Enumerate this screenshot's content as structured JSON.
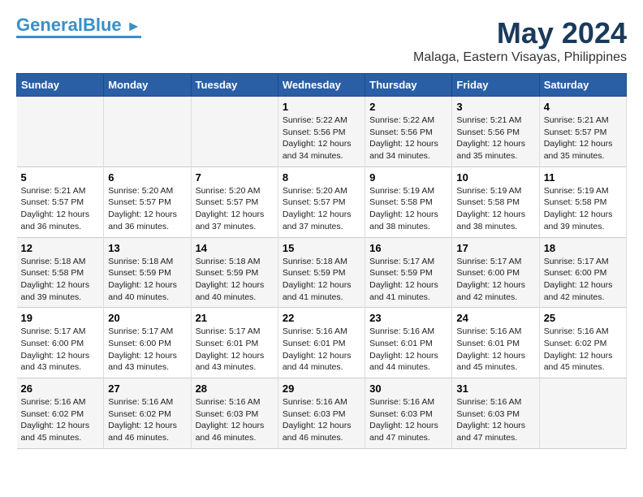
{
  "header": {
    "logo_general": "General",
    "logo_blue": "Blue",
    "title": "May 2024",
    "subtitle": "Malaga, Eastern Visayas, Philippines"
  },
  "days_of_week": [
    "Sunday",
    "Monday",
    "Tuesday",
    "Wednesday",
    "Thursday",
    "Friday",
    "Saturday"
  ],
  "weeks": [
    [
      {
        "day": "",
        "info": ""
      },
      {
        "day": "",
        "info": ""
      },
      {
        "day": "",
        "info": ""
      },
      {
        "day": "1",
        "info": "Sunrise: 5:22 AM\nSunset: 5:56 PM\nDaylight: 12 hours\nand 34 minutes."
      },
      {
        "day": "2",
        "info": "Sunrise: 5:22 AM\nSunset: 5:56 PM\nDaylight: 12 hours\nand 34 minutes."
      },
      {
        "day": "3",
        "info": "Sunrise: 5:21 AM\nSunset: 5:56 PM\nDaylight: 12 hours\nand 35 minutes."
      },
      {
        "day": "4",
        "info": "Sunrise: 5:21 AM\nSunset: 5:57 PM\nDaylight: 12 hours\nand 35 minutes."
      }
    ],
    [
      {
        "day": "5",
        "info": "Sunrise: 5:21 AM\nSunset: 5:57 PM\nDaylight: 12 hours\nand 36 minutes."
      },
      {
        "day": "6",
        "info": "Sunrise: 5:20 AM\nSunset: 5:57 PM\nDaylight: 12 hours\nand 36 minutes."
      },
      {
        "day": "7",
        "info": "Sunrise: 5:20 AM\nSunset: 5:57 PM\nDaylight: 12 hours\nand 37 minutes."
      },
      {
        "day": "8",
        "info": "Sunrise: 5:20 AM\nSunset: 5:57 PM\nDaylight: 12 hours\nand 37 minutes."
      },
      {
        "day": "9",
        "info": "Sunrise: 5:19 AM\nSunset: 5:58 PM\nDaylight: 12 hours\nand 38 minutes."
      },
      {
        "day": "10",
        "info": "Sunrise: 5:19 AM\nSunset: 5:58 PM\nDaylight: 12 hours\nand 38 minutes."
      },
      {
        "day": "11",
        "info": "Sunrise: 5:19 AM\nSunset: 5:58 PM\nDaylight: 12 hours\nand 39 minutes."
      }
    ],
    [
      {
        "day": "12",
        "info": "Sunrise: 5:18 AM\nSunset: 5:58 PM\nDaylight: 12 hours\nand 39 minutes."
      },
      {
        "day": "13",
        "info": "Sunrise: 5:18 AM\nSunset: 5:59 PM\nDaylight: 12 hours\nand 40 minutes."
      },
      {
        "day": "14",
        "info": "Sunrise: 5:18 AM\nSunset: 5:59 PM\nDaylight: 12 hours\nand 40 minutes."
      },
      {
        "day": "15",
        "info": "Sunrise: 5:18 AM\nSunset: 5:59 PM\nDaylight: 12 hours\nand 41 minutes."
      },
      {
        "day": "16",
        "info": "Sunrise: 5:17 AM\nSunset: 5:59 PM\nDaylight: 12 hours\nand 41 minutes."
      },
      {
        "day": "17",
        "info": "Sunrise: 5:17 AM\nSunset: 6:00 PM\nDaylight: 12 hours\nand 42 minutes."
      },
      {
        "day": "18",
        "info": "Sunrise: 5:17 AM\nSunset: 6:00 PM\nDaylight: 12 hours\nand 42 minutes."
      }
    ],
    [
      {
        "day": "19",
        "info": "Sunrise: 5:17 AM\nSunset: 6:00 PM\nDaylight: 12 hours\nand 43 minutes."
      },
      {
        "day": "20",
        "info": "Sunrise: 5:17 AM\nSunset: 6:00 PM\nDaylight: 12 hours\nand 43 minutes."
      },
      {
        "day": "21",
        "info": "Sunrise: 5:17 AM\nSunset: 6:01 PM\nDaylight: 12 hours\nand 43 minutes."
      },
      {
        "day": "22",
        "info": "Sunrise: 5:16 AM\nSunset: 6:01 PM\nDaylight: 12 hours\nand 44 minutes."
      },
      {
        "day": "23",
        "info": "Sunrise: 5:16 AM\nSunset: 6:01 PM\nDaylight: 12 hours\nand 44 minutes."
      },
      {
        "day": "24",
        "info": "Sunrise: 5:16 AM\nSunset: 6:01 PM\nDaylight: 12 hours\nand 45 minutes."
      },
      {
        "day": "25",
        "info": "Sunrise: 5:16 AM\nSunset: 6:02 PM\nDaylight: 12 hours\nand 45 minutes."
      }
    ],
    [
      {
        "day": "26",
        "info": "Sunrise: 5:16 AM\nSunset: 6:02 PM\nDaylight: 12 hours\nand 45 minutes."
      },
      {
        "day": "27",
        "info": "Sunrise: 5:16 AM\nSunset: 6:02 PM\nDaylight: 12 hours\nand 46 minutes."
      },
      {
        "day": "28",
        "info": "Sunrise: 5:16 AM\nSunset: 6:03 PM\nDaylight: 12 hours\nand 46 minutes."
      },
      {
        "day": "29",
        "info": "Sunrise: 5:16 AM\nSunset: 6:03 PM\nDaylight: 12 hours\nand 46 minutes."
      },
      {
        "day": "30",
        "info": "Sunrise: 5:16 AM\nSunset: 6:03 PM\nDaylight: 12 hours\nand 47 minutes."
      },
      {
        "day": "31",
        "info": "Sunrise: 5:16 AM\nSunset: 6:03 PM\nDaylight: 12 hours\nand 47 minutes."
      },
      {
        "day": "",
        "info": ""
      }
    ]
  ]
}
